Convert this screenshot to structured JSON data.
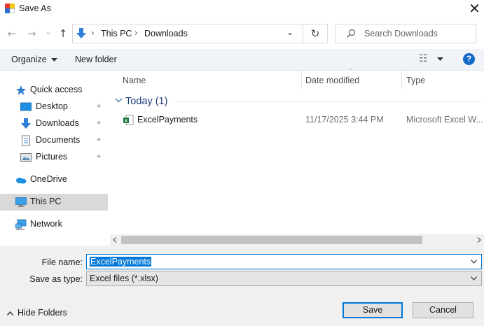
{
  "window": {
    "title": "Save As",
    "close_glyph": "✕"
  },
  "nav": {
    "back_glyph": "←",
    "forward_glyph": "→",
    "recent_glyph": "⌄",
    "up_glyph": "↑"
  },
  "address": {
    "crumbs": [
      "This PC",
      "Downloads"
    ],
    "separator": "›",
    "dropdown_glyph": "⌄",
    "refresh_glyph": "↻"
  },
  "search": {
    "placeholder": "Search Downloads"
  },
  "command_bar": {
    "organize_label": "Organize",
    "new_folder_label": "New folder",
    "view_glyph": "☷",
    "help_glyph": "?"
  },
  "nav_pane": {
    "items": [
      {
        "label": "Quick access",
        "icon": "star-icon"
      },
      {
        "label": "Desktop",
        "icon": "desktop-icon",
        "pinned": true
      },
      {
        "label": "Downloads",
        "icon": "download-icon",
        "pinned": true
      },
      {
        "label": "Documents",
        "icon": "document-icon",
        "pinned": true
      },
      {
        "label": "Pictures",
        "icon": "picture-icon",
        "pinned": true
      },
      {
        "label": "OneDrive",
        "icon": "cloud-icon"
      },
      {
        "label": "This PC",
        "icon": "computer-icon",
        "selected": true
      },
      {
        "label": "Network",
        "icon": "network-icon"
      }
    ],
    "pin_glyph": "📌"
  },
  "file_list": {
    "columns": [
      "Name",
      "Date modified",
      "Type"
    ],
    "group": {
      "label": "Today (1)"
    },
    "files": [
      {
        "name": "ExcelPayments",
        "date": "11/17/2025 3:44 PM",
        "type": "Microsoft Excel W..."
      }
    ]
  },
  "bottom": {
    "file_name_label": "File name:",
    "file_name_value": "ExcelPayments",
    "save_type_label": "Save as type:",
    "save_type_value": "Excel files (*.xlsx)",
    "save_button": "Save",
    "cancel_button": "Cancel",
    "hide_folders_label": "Hide Folders",
    "hide_glyph": "⌃"
  },
  "colors": {
    "accent": "#0078d7",
    "help_blue": "#1468c8",
    "selected_nav": "#d9d9d9"
  }
}
